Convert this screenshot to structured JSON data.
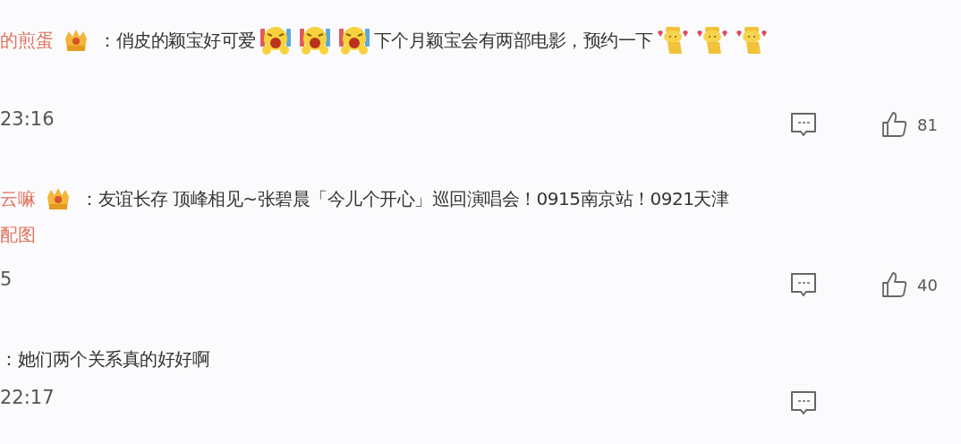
{
  "comments": [
    {
      "name": "的煎蛋",
      "badge": true,
      "content": [
        {
          "kind": "text",
          "text": "：俏皮的颖宝好可爱"
        },
        {
          "kind": "laugh"
        },
        {
          "kind": "laugh"
        },
        {
          "kind": "laugh"
        },
        {
          "kind": "text",
          "text": "下个月颖宝会有两部电影，预约一下"
        },
        {
          "kind": "cheer"
        },
        {
          "kind": "cheer"
        },
        {
          "kind": "cheer"
        }
      ],
      "time": "23:16",
      "reply": true,
      "likes": "81"
    },
    {
      "name": "云嘛",
      "badge": true,
      "content": [
        {
          "kind": "text",
          "text": "：友谊长存 顶峰相见~张碧晨「今儿个开心」巡回演唱会！0915南京站！0921天津"
        }
      ],
      "link": "配图",
      "time": "5",
      "reply": true,
      "likes": "40"
    },
    {
      "badge": false,
      "content": [
        {
          "kind": "text",
          "text": "：她们两个关系真的好好啊"
        }
      ],
      "time": "22:17",
      "reply": true
    }
  ]
}
